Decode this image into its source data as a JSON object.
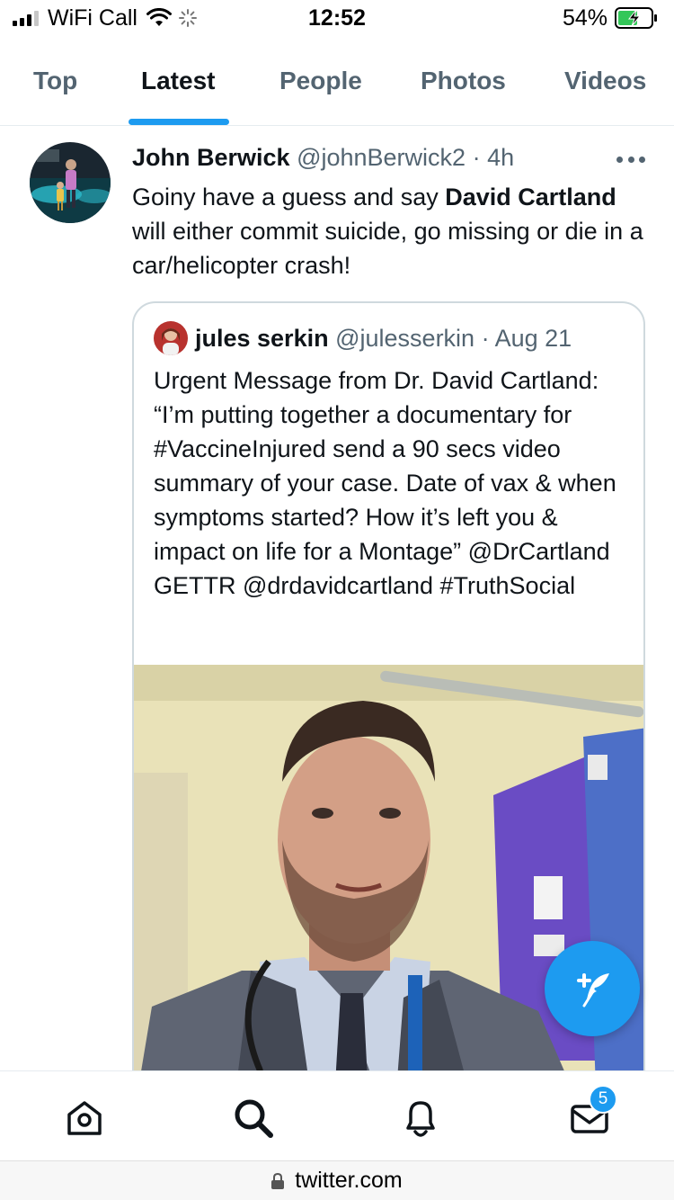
{
  "status_bar": {
    "carrier": "WiFi Call",
    "time": "12:52",
    "battery": "54%"
  },
  "tabs": [
    {
      "label": "Top",
      "active": false
    },
    {
      "label": "Latest",
      "active": true
    },
    {
      "label": "People",
      "active": false
    },
    {
      "label": "Photos",
      "active": false
    },
    {
      "label": "Videos",
      "active": false
    }
  ],
  "tweet": {
    "author_name": "John Berwick",
    "author_handle": "@johnBerwick2",
    "separator": "·",
    "time": "4h",
    "text_before": "Goiny have a guess and say ",
    "text_bold": "David Cartland",
    "text_after": " will either commit suicide, go missing or die in a car/helicopter crash!",
    "quoted": {
      "author_name": "jules serkin",
      "author_handle": "@julesserkin",
      "separator": "·",
      "time": "Aug 21",
      "text": "Urgent Message from Dr. David Cartland: “I’m putting together a documentary for #VaccineInjured send a 90 secs video summary of your case. Date of vax & when symptoms started? How it’s left you & impact on life for a Montage” @DrCartland GETTR @drdavidcartland #TruthSocial"
    }
  },
  "bottom_nav": {
    "items": [
      "home-icon",
      "search-icon",
      "bell-icon",
      "mail-icon"
    ],
    "messages_badge": "5"
  },
  "url_bar": {
    "url": "twitter.com"
  },
  "colors": {
    "accent": "#1d9bf0",
    "secondary_text": "#536471",
    "primary_text": "#0f1419"
  }
}
